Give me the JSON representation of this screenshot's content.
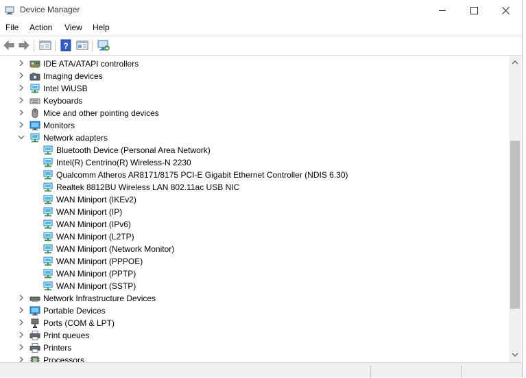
{
  "window": {
    "title": "Device Manager"
  },
  "menu": {
    "file": "File",
    "action": "Action",
    "view": "View",
    "help": "Help"
  },
  "tree": [
    {
      "label": "IDE ATA/ATAPI controllers",
      "level": 0,
      "expanded": false,
      "icon": "ide-controller-icon"
    },
    {
      "label": "Imaging devices",
      "level": 0,
      "expanded": false,
      "icon": "camera-icon"
    },
    {
      "label": "Intel WiUSB",
      "level": 0,
      "expanded": false,
      "icon": "network-icon"
    },
    {
      "label": "Keyboards",
      "level": 0,
      "expanded": false,
      "icon": "keyboard-icon"
    },
    {
      "label": "Mice and other pointing devices",
      "level": 0,
      "expanded": false,
      "icon": "mouse-icon"
    },
    {
      "label": "Monitors",
      "level": 0,
      "expanded": false,
      "icon": "monitor-icon"
    },
    {
      "label": "Network adapters",
      "level": 0,
      "expanded": true,
      "icon": "network-icon"
    },
    {
      "label": "Bluetooth Device (Personal Area Network)",
      "level": 1,
      "icon": "network-icon"
    },
    {
      "label": "Intel(R) Centrino(R) Wireless-N 2230",
      "level": 1,
      "icon": "network-icon"
    },
    {
      "label": "Qualcomm Atheros AR8171/8175 PCI-E Gigabit Ethernet Controller (NDIS 6.30)",
      "level": 1,
      "icon": "network-icon"
    },
    {
      "label": "Realtek 8812BU Wireless LAN 802.11ac USB NIC",
      "level": 1,
      "icon": "network-icon"
    },
    {
      "label": "WAN Miniport (IKEv2)",
      "level": 1,
      "icon": "network-icon"
    },
    {
      "label": "WAN Miniport (IP)",
      "level": 1,
      "icon": "network-icon"
    },
    {
      "label": "WAN Miniport (IPv6)",
      "level": 1,
      "icon": "network-icon"
    },
    {
      "label": "WAN Miniport (L2TP)",
      "level": 1,
      "icon": "network-icon"
    },
    {
      "label": "WAN Miniport (Network Monitor)",
      "level": 1,
      "icon": "network-icon"
    },
    {
      "label": "WAN Miniport (PPPOE)",
      "level": 1,
      "icon": "network-icon"
    },
    {
      "label": "WAN Miniport (PPTP)",
      "level": 1,
      "icon": "network-icon"
    },
    {
      "label": "WAN Miniport (SSTP)",
      "level": 1,
      "icon": "network-icon"
    },
    {
      "label": "Network Infrastructure Devices",
      "level": 0,
      "expanded": false,
      "icon": "infrastructure-device-icon"
    },
    {
      "label": "Portable Devices",
      "level": 0,
      "expanded": false,
      "icon": "monitor-icon"
    },
    {
      "label": "Ports (COM & LPT)",
      "level": 0,
      "expanded": false,
      "icon": "port-icon"
    },
    {
      "label": "Print queues",
      "level": 0,
      "expanded": false,
      "icon": "printer-icon"
    },
    {
      "label": "Printers",
      "level": 0,
      "expanded": false,
      "icon": "printer-icon"
    },
    {
      "label": "Processors",
      "level": 0,
      "expanded": false,
      "icon": "processor-icon"
    }
  ],
  "colors": {
    "accent": "#1e7cd6",
    "network_green": "#3c8a3c"
  }
}
